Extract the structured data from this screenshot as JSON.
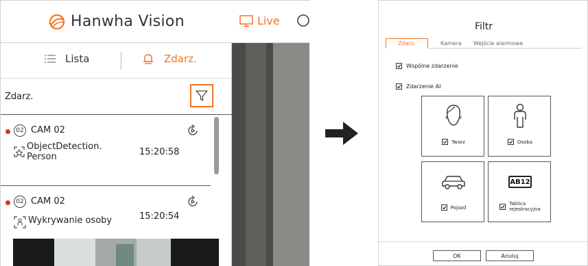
{
  "header": {
    "brand": "Hanwha Vision",
    "live_label": "Live"
  },
  "tabs": {
    "list_label": "Lista",
    "events_label": "Zdarz."
  },
  "filter_row": {
    "label": "Zdarz."
  },
  "events": [
    {
      "channel": "02",
      "camera": "CAM 02",
      "type": "ObjectDetection.\nPerson",
      "time": "15:20:58"
    },
    {
      "channel": "02",
      "camera": "CAM 02",
      "type": "Wykrywanie osoby",
      "time": "15:20:54"
    }
  ],
  "dialog": {
    "title": "Filtr",
    "tabs": [
      "Zdarz.",
      "Kamera",
      "Wejście alarmowe"
    ],
    "common_event": "Wspólne zdarzenie",
    "ai_event": "Zdarzenie AI",
    "tiles": [
      {
        "label": "Twarz",
        "icon": "face-icon"
      },
      {
        "label": "Osoba",
        "icon": "person-icon"
      },
      {
        "label": "Pojazd",
        "icon": "vehicle-icon"
      },
      {
        "label": "Tablica\nrejestracyjna",
        "icon": "license-plate-icon",
        "plate_text": "AB12"
      }
    ],
    "ok_label": "OK",
    "cancel_label": "Anuluj"
  },
  "colors": {
    "accent": "#f37321",
    "event_dot": "#d6302b"
  }
}
